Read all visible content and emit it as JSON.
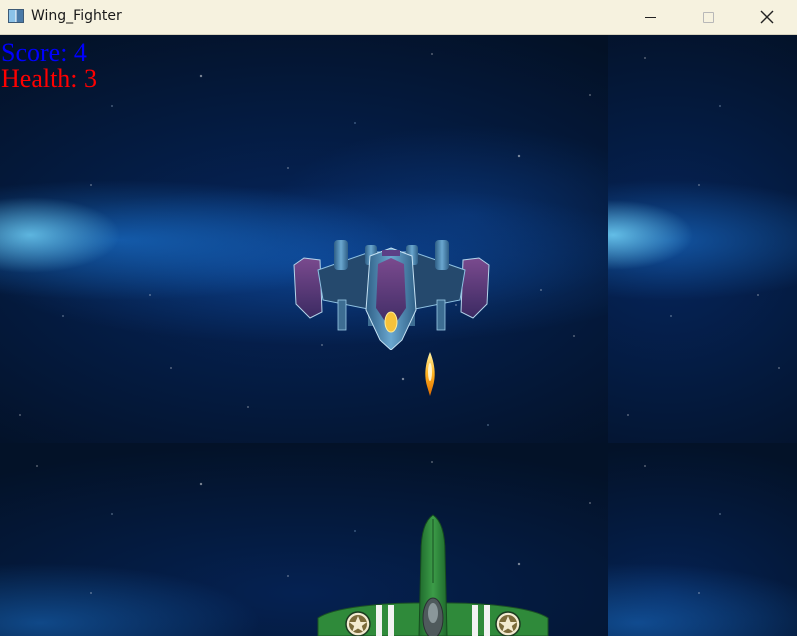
{
  "window": {
    "title": "Wing_Fighter",
    "icon": "app-window-icon",
    "controls": {
      "minimize_icon": "minimize-icon",
      "maximize_icon": "maximize-icon",
      "close_icon": "close-icon"
    }
  },
  "hud": {
    "score_text": "Score: 4",
    "health_text": "Health: 3",
    "score_color": "#0000ff",
    "health_color": "#ff0000"
  },
  "game": {
    "background": "starfield-nebula",
    "enemy": "enemy-spaceship",
    "projectile": "fireball-bullet",
    "player": "green-fighter-plane"
  }
}
